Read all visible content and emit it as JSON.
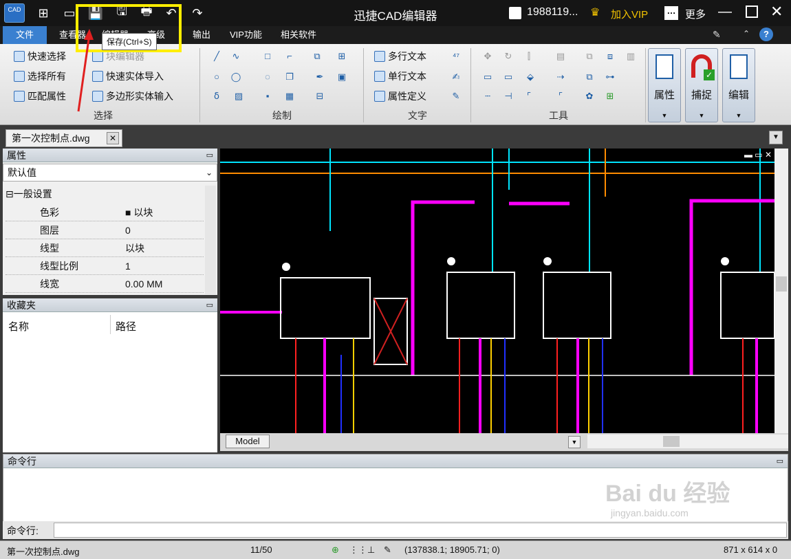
{
  "titlebar": {
    "title": "迅捷CAD编辑器",
    "user": "1988119...",
    "vip": "加入VIP",
    "more": "更多",
    "logo_text": "CAD"
  },
  "tooltip": "保存(Ctrl+S)",
  "menu": [
    "文件",
    "查看器",
    "编辑器",
    "高级",
    "输出",
    "VIP功能",
    "相关软件"
  ],
  "ribbon": {
    "select": {
      "items": [
        "快速选择",
        "选择所有",
        "匹配属性",
        "块编辑器",
        "快速实体导入",
        "多边形实体输入"
      ],
      "label": "选择"
    },
    "draw_label": "绘制",
    "text": {
      "items": [
        "多行文本",
        "单行文本",
        "属性定义"
      ],
      "label": "文字"
    },
    "tools_label": "工具",
    "big_buttons": [
      "属性",
      "捕捉",
      "编辑"
    ]
  },
  "doc_tab": "第一次控制点.dwg",
  "properties": {
    "title": "属性",
    "dropdown": "默认值",
    "section": "一般设置",
    "rows": [
      {
        "k": "色彩",
        "v": "以块"
      },
      {
        "k": "图层",
        "v": "0"
      },
      {
        "k": "线型",
        "v": "以块"
      },
      {
        "k": "线型比例",
        "v": "1"
      },
      {
        "k": "线宽",
        "v": "0.00 MM"
      }
    ]
  },
  "favorites": {
    "title": "收藏夹",
    "col_name": "名称",
    "col_path": "路径"
  },
  "model_tab": "Model",
  "command": {
    "title": "命令行",
    "input_label": "命令行:"
  },
  "status": {
    "file": "第一次控制点.dwg",
    "page": "11/50",
    "coords": "(137838.1; 18905.71; 0)",
    "size": "871 x 614 x 0"
  },
  "watermark": {
    "main": "Bai du 经验",
    "sub": "jingyan.baidu.com"
  },
  "colors": {
    "accent": "#3a80d0",
    "highlight": "#ffee00",
    "vip": "#f2c200",
    "magenta": "#ff00ff",
    "cyan": "#00e5ff",
    "orange": "#ff8c00"
  }
}
